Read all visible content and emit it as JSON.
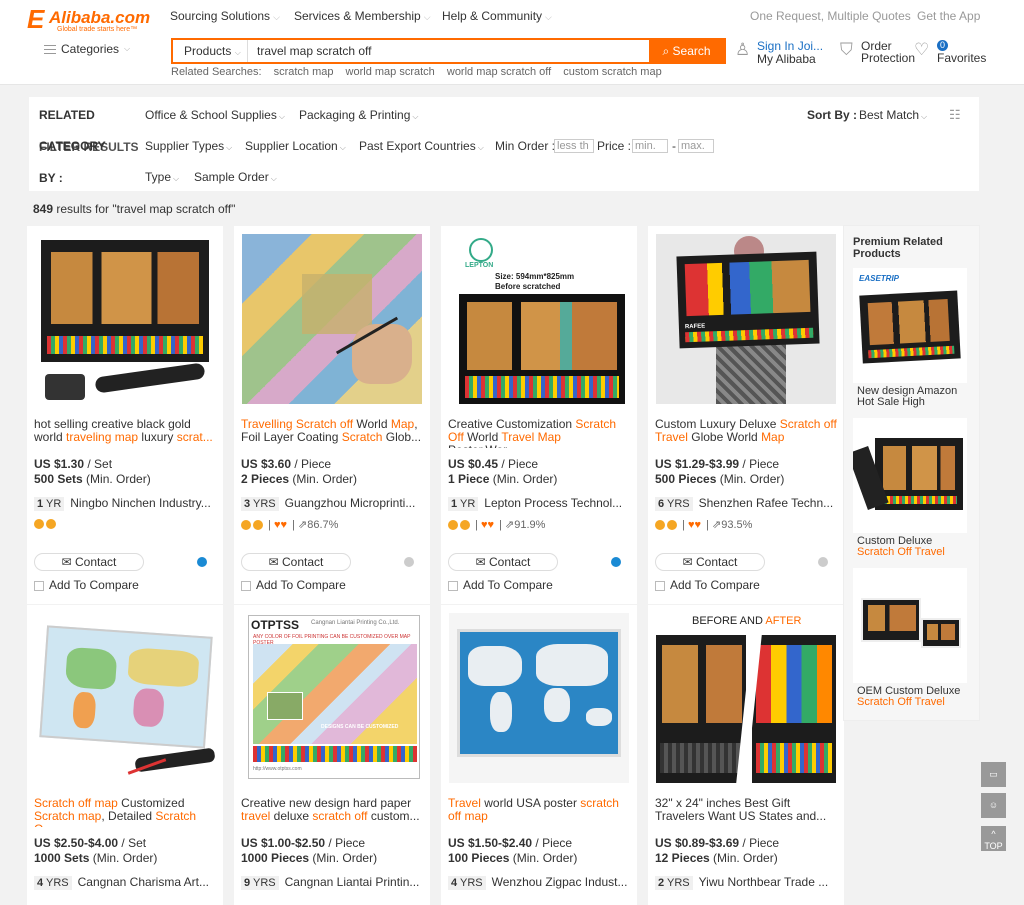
{
  "brand": {
    "name": "Alibaba.com",
    "tagline": "Global trade starts here™"
  },
  "topnav": {
    "sourcing": "Sourcing Solutions",
    "services": "Services & Membership",
    "help": "Help & Community",
    "quotes": "One Request, Multiple Quotes",
    "app": "Get the App"
  },
  "categories_label": "Categories",
  "search": {
    "scope": "Products",
    "value": "travel map scratch off",
    "button": "Search"
  },
  "related_searches": {
    "label": "Related Searches:",
    "items": [
      "scratch map",
      "world map scratch",
      "world map scratch off",
      "custom scratch map"
    ]
  },
  "header_links": {
    "signin": "Sign In",
    "join": "Joi...",
    "my_alibaba": "My Alibaba",
    "order": "Order",
    "protection": "Protection",
    "favorites_count": "0",
    "favorites": "Favorites"
  },
  "filters": {
    "related_label_line1": "RELATED",
    "related_label_line2": "CATEGORY",
    "refine_label": "FILTER RESULTS",
    "by_label": "BY :",
    "cat1": "Office & School Supplies",
    "cat2": "Packaging & Printing",
    "sort_label": "Sort By :",
    "sort_value": "Best Match",
    "supplier_types": "Supplier Types",
    "supplier_location": "Supplier Location",
    "past_export": "Past Export Countries",
    "min_order_label": "Min Order :",
    "min_order_placeholder": "less th",
    "price_label": "Price :",
    "price_min": "min.",
    "price_max": "max.",
    "type": "Type",
    "sample_order": "Sample Order"
  },
  "results": {
    "count": "849",
    "text": " results for \"travel map scratch off\""
  },
  "products": [
    {
      "title_parts": [
        {
          "t": "hot selling creative black gold world ",
          "h": false
        },
        {
          "t": "traveling map",
          "h": true
        },
        {
          "t": " luxury ",
          "h": false
        },
        {
          "t": "scrat...",
          "h": true
        }
      ],
      "price": "US $1.30",
      "unit": " / Set",
      "moq": "500 Sets",
      "moq_suffix": " (Min. Order)",
      "years": "1",
      "yrs_label": "YR",
      "supplier": "Ningbo Ninchen Industry...",
      "rate": "",
      "dot_color": "#1a8ad4"
    },
    {
      "title_parts": [
        {
          "t": "Travelling Scratch off",
          "h": true
        },
        {
          "t": " World ",
          "h": false
        },
        {
          "t": "Map",
          "h": true
        },
        {
          "t": ", Foil Layer Coating ",
          "h": false
        },
        {
          "t": "Scratch",
          "h": true
        },
        {
          "t": " Glob...",
          "h": false
        }
      ],
      "price": "US $3.60",
      "unit": " / Piece",
      "moq": "2 Pieces",
      "moq_suffix": " (Min. Order)",
      "years": "3",
      "yrs_label": "YRS",
      "supplier": "Guangzhou Microprinti...",
      "rate": "86.7%",
      "dot_color": "#ccc"
    },
    {
      "title_parts": [
        {
          "t": "Creative Customization ",
          "h": false
        },
        {
          "t": "Scratch Off",
          "h": true
        },
        {
          "t": " World ",
          "h": false
        },
        {
          "t": "Travel Map",
          "h": true
        },
        {
          "t": " Poster,Wor...",
          "h": false
        }
      ],
      "price": "US $0.45",
      "unit": " / Piece",
      "moq": "1 Piece",
      "moq_suffix": " (Min. Order)",
      "years": "1",
      "yrs_label": "YR",
      "supplier": "Lepton Process Technol...",
      "rate": "91.9%",
      "dot_color": "#1a8ad4"
    },
    {
      "title_parts": [
        {
          "t": "Custom Luxury Deluxe ",
          "h": false
        },
        {
          "t": "Scratch off Travel",
          "h": true
        },
        {
          "t": " Globe World ",
          "h": false
        },
        {
          "t": "Map",
          "h": true
        }
      ],
      "price": "US $1.29-$3.99",
      "unit": " / Piece",
      "moq": "500 Pieces",
      "moq_suffix": " (Min. Order)",
      "years": "6",
      "yrs_label": "YRS",
      "supplier": "Shenzhen Rafee Techn...",
      "rate": "93.5%",
      "dot_color": "#ccc"
    },
    {
      "title_parts": [
        {
          "t": "Scratch off map",
          "h": true
        },
        {
          "t": " Customized ",
          "h": false
        },
        {
          "t": "Scratch map",
          "h": true
        },
        {
          "t": ", Detailed ",
          "h": false
        },
        {
          "t": "Scratch O...",
          "h": true
        }
      ],
      "price": "US $2.50-$4.00",
      "unit": " / Set",
      "moq": "1000 Sets",
      "moq_suffix": " (Min. Order)",
      "years": "4",
      "yrs_label": "YRS",
      "supplier": "Cangnan Charisma Art..."
    },
    {
      "title_parts": [
        {
          "t": "Creative new design hard paper ",
          "h": false
        },
        {
          "t": "travel",
          "h": true
        },
        {
          "t": " deluxe ",
          "h": false
        },
        {
          "t": "scratch off",
          "h": true
        },
        {
          "t": " custom...",
          "h": false
        }
      ],
      "price": "US $1.00-$2.50",
      "unit": " / Piece",
      "moq": "1000 Pieces",
      "moq_suffix": " (Min. Order)",
      "years": "9",
      "yrs_label": "YRS",
      "supplier": "Cangnan Liantai Printin..."
    },
    {
      "title_parts": [
        {
          "t": "Travel",
          "h": true
        },
        {
          "t": " world USA poster ",
          "h": false
        },
        {
          "t": "scratch off map",
          "h": true
        }
      ],
      "price": "US $1.50-$2.40",
      "unit": " / Piece",
      "moq": "100 Pieces",
      "moq_suffix": " (Min. Order)",
      "years": "4",
      "yrs_label": "YRS",
      "supplier": "Wenzhou Zigpac Indust..."
    },
    {
      "title_parts": [
        {
          "t": "32\" x 24\" inches Best Gift Travelers Want US States and...",
          "h": false
        }
      ],
      "price": "US $0.89-$3.69",
      "unit": " / Piece",
      "moq": "12 Pieces",
      "moq_suffix": " (Min. Order)",
      "years": "2",
      "yrs_label": "YRS",
      "supplier": "Yiwu Northbear Trade ..."
    }
  ],
  "image_text": {
    "lepton": "LEPTON",
    "size": "Size: 594mm*825mm",
    "before": "Before scratched",
    "rafee": "RAFEE",
    "otptss": "OTPTSS",
    "cangnan": "Cangnan Liantai Printing Co.,Ltd.",
    "any_color": "ANY COLOR OF FOIL PRINTING CAN BE CUSTOMIZED OVER MAP POSTER",
    "designs": "DESIGNS CAN BE CUSTOMIZED",
    "site": "http://www.otptss.com",
    "before_after_1": "BEFORE AND ",
    "before_after_2": "AFTER",
    "easetrip": "EASETRIP"
  },
  "card_actions": {
    "contact": "Contact",
    "compare": "Add To Compare"
  },
  "premium": {
    "title": "Premium Related Products",
    "items": [
      {
        "l1": "New design Amazon",
        "l2": "Hot Sale High",
        "l2_hl": false
      },
      {
        "l1": "Custom Deluxe",
        "l2": "Scratch Off Travel",
        "l2_hl": true
      },
      {
        "l1": "OEM Custom Deluxe",
        "l2": "Scratch Off Travel",
        "l2_hl": true
      }
    ]
  },
  "side_buttons": {
    "top": "TOP"
  }
}
